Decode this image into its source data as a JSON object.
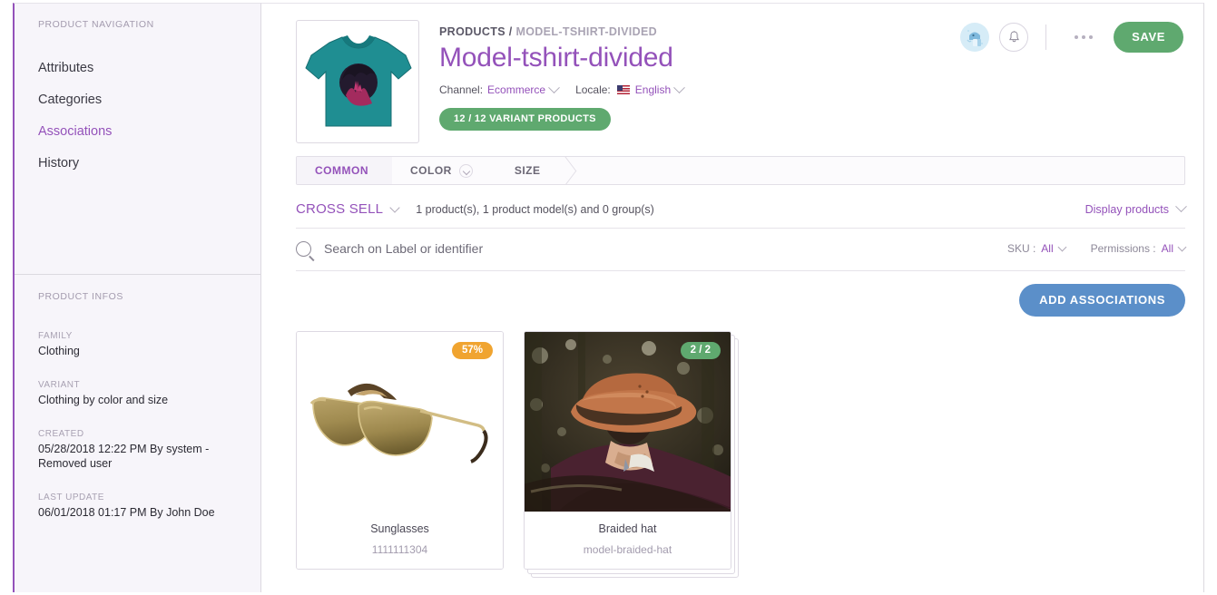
{
  "sidebar": {
    "nav_section_title": "PRODUCT NAVIGATION",
    "nav_items": [
      {
        "label": "Attributes",
        "active": false
      },
      {
        "label": "Categories",
        "active": false
      },
      {
        "label": "Associations",
        "active": true
      },
      {
        "label": "History",
        "active": false
      }
    ],
    "infos_section_title": "PRODUCT INFOS",
    "infos": [
      {
        "label": "FAMILY",
        "value": "Clothing"
      },
      {
        "label": "VARIANT",
        "value": "Clothing by color and size"
      },
      {
        "label": "CREATED",
        "value": "05/28/2018 12:22 PM By system - Removed user"
      },
      {
        "label": "LAST UPDATE",
        "value": "06/01/2018 01:17 PM By John Doe"
      }
    ]
  },
  "header": {
    "breadcrumb_root": "PRODUCTS",
    "breadcrumb_sep": "/",
    "breadcrumb_current": "MODEL-TSHIRT-DIVIDED",
    "title": "Model-tshirt-divided",
    "channel_label": "Channel:",
    "channel_value": "Ecommerce",
    "locale_label": "Locale:",
    "locale_value": "English",
    "variant_badge": "12 / 12 VARIANT PRODUCTS",
    "avatar_icon": "user-avatar-icon",
    "bell_icon": "notification-bell-icon",
    "more_icon": "more-options-icon",
    "save_label": "SAVE"
  },
  "tabs": [
    {
      "label": "COMMON",
      "active": true,
      "has_chevron": false
    },
    {
      "label": "COLOR",
      "active": false,
      "has_chevron": true
    },
    {
      "label": "SIZE",
      "active": false,
      "has_chevron": false
    }
  ],
  "cross_sell": {
    "title": "CROSS SELL",
    "count_text": "1 product(s), 1 product model(s) and 0 group(s)",
    "display_products_label": "Display products"
  },
  "search": {
    "placeholder": "Search on Label or identifier",
    "value": "",
    "icon": "search-icon",
    "filters": [
      {
        "label": "SKU :",
        "value": "All"
      },
      {
        "label": "Permissions :",
        "value": "All"
      }
    ]
  },
  "actions": {
    "add_associations_label": "ADD ASSOCIATIONS"
  },
  "cards": [
    {
      "badge": "57%",
      "badge_color": "#f0a430",
      "label": "Sunglasses",
      "sub": "1111111304",
      "stacked": false
    },
    {
      "badge": "2 / 2",
      "badge_color": "#5fa96f",
      "label": "Braided hat",
      "sub": "model-braided-hat",
      "stacked": true
    }
  ],
  "colors": {
    "accent_purple": "#9452ba",
    "green": "#5fa96f",
    "blue": "#5b8fc9",
    "orange": "#f0a430",
    "sidebar_bg": "#f7f5fa"
  }
}
